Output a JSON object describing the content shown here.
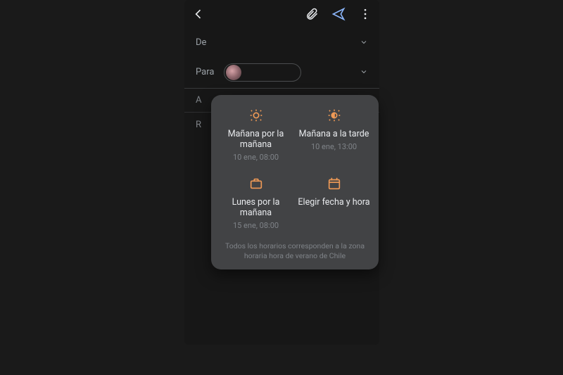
{
  "topbar": {
    "back": "←",
    "attach": "attach",
    "send": "➤",
    "more": "⋮"
  },
  "fields": {
    "from_label": "De",
    "to_label": "Para",
    "subject_initial": "A",
    "body_initial": "R"
  },
  "card": {
    "options": [
      {
        "title": "Mañana por la mañana",
        "sub": "10 ene, 08:00"
      },
      {
        "title": "Mañana a la tarde",
        "sub": "10 ene, 13:00"
      },
      {
        "title": "Lunes por la mañana",
        "sub": "15 ene, 08:00"
      },
      {
        "title": "Elegir fecha y hora",
        "sub": ""
      }
    ],
    "timezone": "Todos los horarios corresponden a la zona horaria hora de verano de Chile"
  },
  "colors": {
    "accent": "#f09a56",
    "icon_blue": "#8ab4f8"
  }
}
